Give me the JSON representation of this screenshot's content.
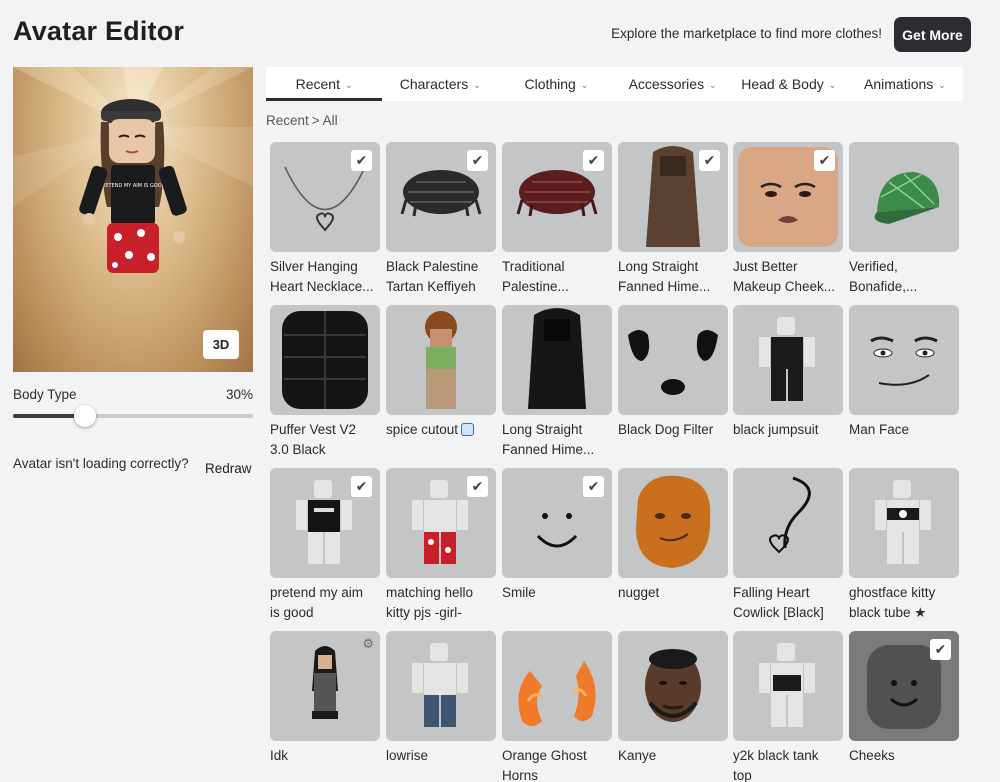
{
  "header": {
    "title": "Avatar Editor",
    "promo_text": "Explore the marketplace to find more clothes!",
    "get_more_label": "Get More"
  },
  "avatar": {
    "view_toggle_label": "3D",
    "shirt_text": "PRETEND MY AIM IS GOOD."
  },
  "body_type": {
    "label": "Body Type",
    "value_text": "30%",
    "value": 0.3
  },
  "loading": {
    "text": "Avatar isn't loading correctly?",
    "redraw_label": "Redraw"
  },
  "tabs": [
    {
      "label": "Recent",
      "active": true
    },
    {
      "label": "Characters",
      "active": false
    },
    {
      "label": "Clothing",
      "active": false
    },
    {
      "label": "Accessories",
      "active": false
    },
    {
      "label": "Head & Body",
      "active": false
    },
    {
      "label": "Animations",
      "active": false
    }
  ],
  "breadcrumb": {
    "root": "Recent",
    "separator": ">",
    "current": "All"
  },
  "icons": {
    "check": "check-icon",
    "chevron": "chevron-down-icon",
    "gear": "gear-icon",
    "cube": "3d-cube-icon"
  },
  "items": [
    {
      "line1": "Silver Hanging",
      "line2": "Heart Necklace...",
      "selected": true
    },
    {
      "line1": "Black Palestine",
      "line2": "Tartan Keffiyeh",
      "selected": true
    },
    {
      "line1": "Traditional",
      "line2": "Palestine...",
      "selected": true
    },
    {
      "line1": "Long Straight",
      "line2": "Fanned Hime...",
      "selected": true
    },
    {
      "line1": "Just Better",
      "line2": "Makeup Cheek...",
      "selected": true
    },
    {
      "line1": "Verified,",
      "line2": "Bonafide,...",
      "selected": false
    },
    {
      "line1": "Puffer Vest V2",
      "line2": "3.0 Black",
      "selected": false
    },
    {
      "line1": "spice cutout",
      "line2": "",
      "selected": false,
      "cube": true
    },
    {
      "line1": "Long Straight",
      "line2": "Fanned Hime...",
      "selected": false
    },
    {
      "line1": "Black Dog Filter",
      "line2": "",
      "selected": false
    },
    {
      "line1": "black jumpsuit",
      "line2": "",
      "selected": false
    },
    {
      "line1": "Man Face",
      "line2": "",
      "selected": false
    },
    {
      "line1": "pretend my aim",
      "line2": "is good",
      "selected": true
    },
    {
      "line1": "matching hello",
      "line2": "kitty pjs -girl-",
      "selected": true
    },
    {
      "line1": "Smile",
      "line2": "",
      "selected": true
    },
    {
      "line1": "nugget",
      "line2": "",
      "selected": false
    },
    {
      "line1": "Falling Heart",
      "line2": "Cowlick [Black]",
      "selected": false
    },
    {
      "line1": "ghostface kitty",
      "line2": "black tube ★",
      "selected": false
    },
    {
      "line1": "Idk",
      "line2": "",
      "selected": false,
      "gear": true
    },
    {
      "line1": "lowrise",
      "line2": "",
      "selected": false
    },
    {
      "line1": "Orange Ghost",
      "line2": "Horns",
      "selected": false
    },
    {
      "line1": "Kanye",
      "line2": "",
      "selected": false
    },
    {
      "line1": "y2k black tank",
      "line2": "top",
      "selected": false
    },
    {
      "line1": "Cheeks",
      "line2": "",
      "selected": true
    }
  ]
}
